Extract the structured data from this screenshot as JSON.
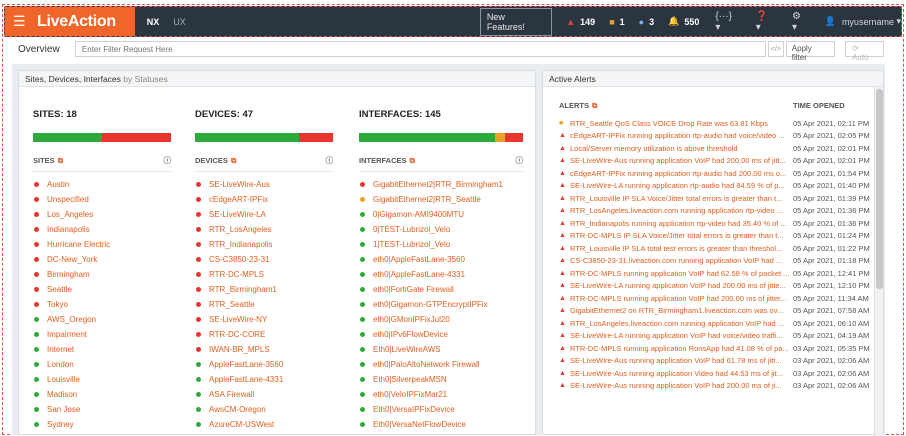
{
  "topbar": {
    "logo": "LiveAction",
    "tabs": [
      "NX",
      "UX"
    ],
    "new_features": "New Features!",
    "badges": [
      {
        "symbol": "▲",
        "color": "#e8433a",
        "count": "149"
      },
      {
        "symbol": "■",
        "color": "#e8a22a",
        "count": "1"
      },
      {
        "symbol": "●",
        "color": "#7db3e8",
        "count": "3"
      },
      {
        "symbol": "🔔",
        "color": "#4a90d9",
        "count": "550"
      }
    ],
    "tools": [
      "{···} ▾",
      "❓ ▾",
      "⚙ ▾"
    ],
    "username": "myusername"
  },
  "filterbar": {
    "title": "Overview",
    "placeholder": "Enter Filter Request Here",
    "code_button": "</>",
    "apply_label": "Apply filter",
    "auto_label": "Auto"
  },
  "left_panel": {
    "title": "Sites, Devices, Interfaces",
    "subtitle": "by Statuses"
  },
  "columns": [
    {
      "title": "SITES: 18",
      "bar": [
        {
          "color": "#2eaa3c",
          "pct": 50
        },
        {
          "color": "#e8352e",
          "pct": 50
        }
      ],
      "header": "SITES",
      "items": [
        {
          "label": "Austin",
          "color": "#e8352e"
        },
        {
          "label": "Unspecified",
          "color": "#e8352e"
        },
        {
          "label": "Los_Angeles",
          "color": "#e8352e"
        },
        {
          "label": "Indianapolis",
          "color": "#e8352e"
        },
        {
          "label": "Hurricane Electric",
          "color": "#e8352e"
        },
        {
          "label": "DC-New_York",
          "color": "#e8352e"
        },
        {
          "label": "Birmingham",
          "color": "#e8352e"
        },
        {
          "label": "Seattle",
          "color": "#e8352e"
        },
        {
          "label": "Tokyo",
          "color": "#e8352e"
        },
        {
          "label": "AWS_Oregon",
          "color": "#2eaa3c"
        },
        {
          "label": "Impairment",
          "color": "#2eaa3c"
        },
        {
          "label": "Internet",
          "color": "#2eaa3c"
        },
        {
          "label": "London",
          "color": "#2eaa3c"
        },
        {
          "label": "Louisville",
          "color": "#2eaa3c"
        },
        {
          "label": "Madison",
          "color": "#2eaa3c"
        },
        {
          "label": "San Jose",
          "color": "#2eaa3c"
        },
        {
          "label": "Sydney",
          "color": "#2eaa3c"
        }
      ]
    },
    {
      "title": "DEVICES: 47",
      "bar": [
        {
          "color": "#2eaa3c",
          "pct": 75
        },
        {
          "color": "#e8352e",
          "pct": 25
        }
      ],
      "header": "DEVICES",
      "items": [
        {
          "label": "SE-LiveWire-Aus",
          "color": "#e8352e"
        },
        {
          "label": "cEdgeART-IPFix",
          "color": "#e8352e"
        },
        {
          "label": "SE-LiveWire-LA",
          "color": "#e8352e"
        },
        {
          "label": "RTR_LosAngeles",
          "color": "#e8352e"
        },
        {
          "label": "RTR_Indianapolis",
          "color": "#e8352e"
        },
        {
          "label": "CS-C3850-23-31",
          "color": "#e8352e"
        },
        {
          "label": "RTR-DC-MPLS",
          "color": "#e8352e"
        },
        {
          "label": "RTR_Birmingham1",
          "color": "#e8352e"
        },
        {
          "label": "RTR_Seattle",
          "color": "#e8352e"
        },
        {
          "label": "SE-LiveWire-NY",
          "color": "#e8352e"
        },
        {
          "label": "RTR-DC-CORE",
          "color": "#e8352e"
        },
        {
          "label": "IWAN-BR_MPLS",
          "color": "#e8352e"
        },
        {
          "label": "AppleFastLane-3560",
          "color": "#2eaa3c"
        },
        {
          "label": "AppleFastLane-4331",
          "color": "#2eaa3c"
        },
        {
          "label": "ASA Firewall",
          "color": "#2eaa3c"
        },
        {
          "label": "AwsCM-Oregon",
          "color": "#2eaa3c"
        },
        {
          "label": "AzureCM-USWest",
          "color": "#2eaa3c"
        }
      ]
    },
    {
      "title": "INTERFACES: 145",
      "bar": [
        {
          "color": "#2eaa3c",
          "pct": 83
        },
        {
          "color": "#e8a22a",
          "pct": 6
        },
        {
          "color": "#e8352e",
          "pct": 11
        }
      ],
      "header": "INTERFACES",
      "items": [
        {
          "label": "GigabitEthernet2|RTR_Birmingham1",
          "color": "#e8352e"
        },
        {
          "label": "GigabitEthernet2|RTR_Seattle",
          "color": "#e8a22a"
        },
        {
          "label": "0|Gigamon-AMI9400MTU",
          "color": "#2eaa3c"
        },
        {
          "label": "0|TEST-Lubrizol_Velo",
          "color": "#2eaa3c"
        },
        {
          "label": "1|TEST-Lubrizol_Velo",
          "color": "#2eaa3c"
        },
        {
          "label": "eth0|AppleFastLane-3560",
          "color": "#2eaa3c"
        },
        {
          "label": "eth0|AppleFastLane-4331",
          "color": "#2eaa3c"
        },
        {
          "label": "eth0|FortiGate Firewall",
          "color": "#2eaa3c"
        },
        {
          "label": "eth0|Gigamon-GTPEncryptIPFix",
          "color": "#2eaa3c"
        },
        {
          "label": "eth0|GMonIPFixJul20",
          "color": "#2eaa3c"
        },
        {
          "label": "eth0|IPv6FlowDevice",
          "color": "#2eaa3c"
        },
        {
          "label": "Eth0|LiveWireAWS",
          "color": "#2eaa3c"
        },
        {
          "label": "eth0|PaloAltoNetwork Firewall",
          "color": "#2eaa3c"
        },
        {
          "label": "Eth0|SilverpeakMSN",
          "color": "#2eaa3c"
        },
        {
          "label": "eth0|VeloIPFixMar21",
          "color": "#2eaa3c"
        },
        {
          "label": "Eth0|VersaIPFixDevice",
          "color": "#2eaa3c"
        },
        {
          "label": "Eth0|VersaNetFlowDevice",
          "color": "#2eaa3c"
        }
      ]
    }
  ],
  "right_panel": {
    "title": "Active Alerts",
    "alerts_header": "ALERTS",
    "time_header": "TIME OPENED",
    "alerts": [
      {
        "sev": "■",
        "color": "#e8a22a",
        "msg": "RTR_Seattle QoS Class VOICE Drop Rate was 63.81 Kbps",
        "time": "05 Apr 2021, 02:11 PM"
      },
      {
        "sev": "▲",
        "color": "#e8352e",
        "msg": "cEdgeART-IPFix running application rtp-audio had voice/video ...",
        "time": "05 Apr 2021, 02:05 PM"
      },
      {
        "sev": "▲",
        "color": "#e8352e",
        "msg": "Local/Server memory utilization is above threshold",
        "time": "05 Apr 2021, 02:01 PM"
      },
      {
        "sev": "▲",
        "color": "#e8352e",
        "msg": "SE-LiveWire-Aus running application VoIP had 200.00 ms of jitt...",
        "time": "05 Apr 2021, 02:01 PM"
      },
      {
        "sev": "▲",
        "color": "#e8352e",
        "msg": "cEdgeART-IPFix running application rtp-audio had 200.00 ms o...",
        "time": "05 Apr 2021, 01:54 PM"
      },
      {
        "sev": "▲",
        "color": "#e8352e",
        "msg": "SE-LiveWire-LA running application rtp-audio had 84.59 % of p...",
        "time": "05 Apr 2021, 01:40 PM"
      },
      {
        "sev": "▲",
        "color": "#e8352e",
        "msg": "RTR_Louisville IP SLA Voice/Jitter total errors is greater than t...",
        "time": "05 Apr 2021, 01:39 PM"
      },
      {
        "sev": "▲",
        "color": "#e8352e",
        "msg": "RTR_LosAngeles.liveaction.com running application rtp-video ...",
        "time": "05 Apr 2021, 01:36 PM"
      },
      {
        "sev": "▲",
        "color": "#e8352e",
        "msg": "RTR_Indianapolis running application rtp-video had 35.40 % of ...",
        "time": "05 Apr 2021, 01:36 PM"
      },
      {
        "sev": "▲",
        "color": "#e8352e",
        "msg": "RTR-DC-MPLS IP SLA Voice/Jitter total errors is greater than t...",
        "time": "05 Apr 2021, 01:24 PM"
      },
      {
        "sev": "▲",
        "color": "#e8352e",
        "msg": "RTR_Louisville IP SLA total test errors is greater than threshol...",
        "time": "05 Apr 2021, 01:22 PM"
      },
      {
        "sev": "▲",
        "color": "#e8352e",
        "msg": "CS-C3850-23-31.liveaction.com running application VoIP had ...",
        "time": "05 Apr 2021, 01:18 PM"
      },
      {
        "sev": "▲",
        "color": "#e8352e",
        "msg": "RTR-DC-MPLS running application VoIP had 62.58 % of packet ...",
        "time": "05 Apr 2021, 12:41 PM"
      },
      {
        "sev": "▲",
        "color": "#e8352e",
        "msg": "SE-LiveWire-LA running application VoIP had 200.00 ms of jitte...",
        "time": "05 Apr 2021, 12:10 PM"
      },
      {
        "sev": "▲",
        "color": "#e8352e",
        "msg": "RTR-DC-MPLS running application VoIP had 200.00 ms of jitter...",
        "time": "05 Apr 2021, 11:34 AM"
      },
      {
        "sev": "▲",
        "color": "#e8352e",
        "msg": "GigabitEthernet2 on RTR_Birmingham1.liveaction.com was ov...",
        "time": "05 Apr 2021, 07:58 AM"
      },
      {
        "sev": "▲",
        "color": "#e8352e",
        "msg": "RTR_LosAngeles.liveaction.com running application VoIP had ...",
        "time": "05 Apr 2021, 06:10 AM"
      },
      {
        "sev": "▲",
        "color": "#e8352e",
        "msg": "SE-LiveWire-LA running application VoIP had voice/video traffi...",
        "time": "05 Apr 2021, 04:19 AM"
      },
      {
        "sev": "▲",
        "color": "#e8352e",
        "msg": "RTR-DC-MPLS running application RonsApp had 41.08 % of pa...",
        "time": "03 Apr 2021, 05:35 PM"
      },
      {
        "sev": "▲",
        "color": "#e8352e",
        "msg": "SE-LiveWire-Aus running application VoIP had 61.78 ms of jitt...",
        "time": "03 Apr 2021, 02:06 AM"
      },
      {
        "sev": "▲",
        "color": "#e8352e",
        "msg": "SE-LiveWire-Aus running application Video had 44.53 ms of jit...",
        "time": "03 Apr 2021, 02:06 AM"
      },
      {
        "sev": "▲",
        "color": "#e8352e",
        "msg": "SE-LiveWire-Aus running application VoIP had 200.00 ms of ji...",
        "time": "03 Apr 2021, 02:06 AM"
      }
    ]
  }
}
